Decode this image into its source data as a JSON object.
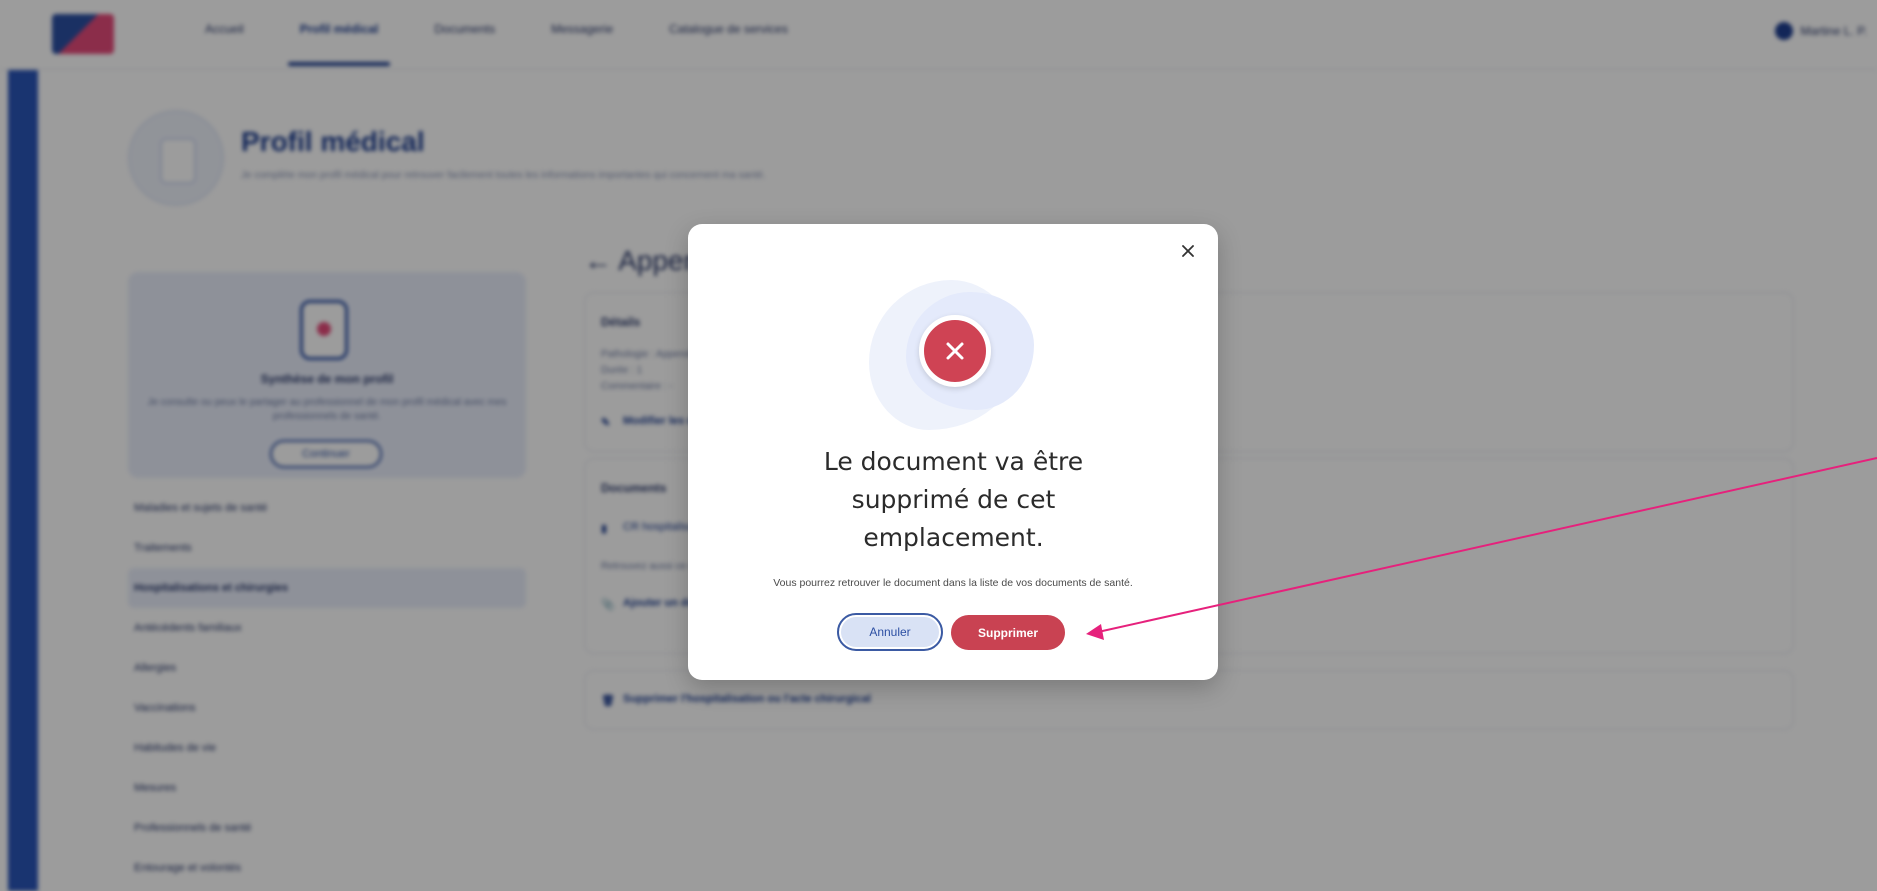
{
  "app": {
    "nav": [
      {
        "label": "Accueil",
        "active": false
      },
      {
        "label": "Profil médical",
        "active": true
      },
      {
        "label": "Documents",
        "active": false
      },
      {
        "label": "Messagerie",
        "active": false
      },
      {
        "label": "Catalogue de services",
        "active": false
      }
    ],
    "user_name": "Martine L. P."
  },
  "header": {
    "title": "Profil médical",
    "subtitle": "Je complète mon profil médical pour retrouver facilement toutes les informations importantes qui concernent ma santé."
  },
  "sidebar_card": {
    "title": "Synthèse de mon profil",
    "description": "Je consulte ou peux le partager au professionnel de mon profil médical avec mes professionnels de santé.",
    "button": "Continuer"
  },
  "sidebar_menu": [
    {
      "label": "Maladies et sujets de santé",
      "active": false
    },
    {
      "label": "Traitements",
      "active": false
    },
    {
      "label": "Hospitalisations et chirurgies",
      "active": true
    },
    {
      "label": "Antécédents familiaux",
      "active": false
    },
    {
      "label": "Allergies",
      "active": false
    },
    {
      "label": "Vaccinations",
      "active": false
    },
    {
      "label": "Habitudes de vie",
      "active": false
    },
    {
      "label": "Mesures",
      "active": false
    },
    {
      "label": "Professionnels de santé",
      "active": false
    },
    {
      "label": "Entourage et volontés",
      "active": false
    }
  ],
  "main": {
    "section_title": "Appendicite",
    "details": {
      "title": "Détails",
      "lines": [
        "Pathologie : Appendicite",
        "Durée : 1",
        "Commentaire : -"
      ],
      "edit_link": "Modifier les détails"
    },
    "documents": {
      "title": "Documents",
      "file": "CR hospitalisation",
      "note": "Retrouvez aussi ce document dans la liste de vos documents de santé.",
      "add_link": "Ajouter un document"
    },
    "delete_link": "Supprimer l'hospitalisation ou l'acte chirurgical"
  },
  "modal": {
    "title": "Le document va être supprimé de cet emplacement.",
    "description": "Vous pourrez retrouver le document dans la liste de vos documents de santé.",
    "cancel_label": "Annuler",
    "confirm_label": "Supprimer"
  },
  "colors": {
    "primary": "#1f3f91",
    "danger": "#c94252",
    "annotation_arrow": "#e6217c"
  }
}
